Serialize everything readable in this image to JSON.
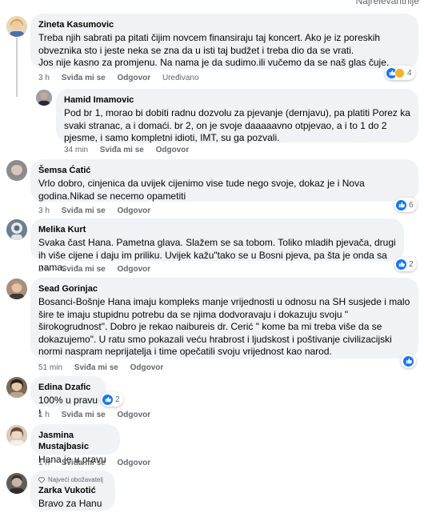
{
  "header": {
    "sort_label": "Najrelevantnije"
  },
  "labels": {
    "like": "Sviđa mi se",
    "reply": "Odgovor",
    "edited": "Uređivano"
  },
  "comments": [
    {
      "author": "Zineta Kasumovic",
      "text": "Treba njih sabrati pa pitati čijim novcem finansiraju taj koncert. Ako je iz poreskih obveznika sto i jeste neka se zna da u isti taj budžet i treba dio da se vrati.\nJos nije kasno za promjenu. Na nama je da sudimo.ili vučemo da se naš glas čuje.",
      "time": "3 h",
      "reactions": "4"
    },
    {
      "author": "Hamid Imamovic",
      "text": "Pod br 1, morao bi dobiti radnu dozvolu za pjevanje (dernjavu), pa platiti Porez ka svaki stranac, a i domaći. br 2, on je svoje daaaaavno otpjevao, a i to 1 do 2 pjesme, i samo kompletni idioti, IMT, su ga pozvali.",
      "time": "34 min"
    },
    {
      "author": "Šemsa Ćatić",
      "text": "Vrlo dobro, cinjenica da uvijek cijenimo vise tude nego svoje, dokaz je i Nova godina.Nikad se necemo opametiti",
      "time": "3 h",
      "reactions": "6"
    },
    {
      "author": "Melika Kurt",
      "text": "Svaka čast Hana. Pametna glava. Slažem se sa tobom. Toliko mladih pjevača, drugi ih više cijene i daju im priliku. Uvijek kažu\"tako se u Bosni pjeva, pa šta je onda sa nama.",
      "time": "2 h",
      "reactions": "2"
    },
    {
      "author": "Sead Gorinjac",
      "text": "Bosanci-Bošnje Hana imaju kompleks manje vrijednosti u odnosu na SH susjede i malo šire te imaju stupidnu potrebu da se njima dodvoravaju i dokazuju svoju \" širokogrudnost\". Dobro je rekao naibureis dr. Cerić \" kome ba mi treba više da se dokazujemo\". U ratu smo pokazali veću hrabrost i ljudskost i poštivanje civilizacijski normi naspram neprijatelja i time opečatili svoju vrijednost kao narod.",
      "time": "51 min"
    },
    {
      "author": "Edina Dzafic",
      "text": "100% u pravu !",
      "time": "1 h",
      "reactions": "2"
    },
    {
      "author": "Jasmina Mustajbasic",
      "text": "Hana je u pravu",
      "time": "1 h"
    },
    {
      "author": "Zarka Vukotić",
      "badge": "Najveći obožavatelj",
      "text": "Bravo za Hanu"
    }
  ],
  "colors": {
    "bubble": "#f0f2f5",
    "like_blue": "#1877f2",
    "muted_text": "#65676b"
  }
}
